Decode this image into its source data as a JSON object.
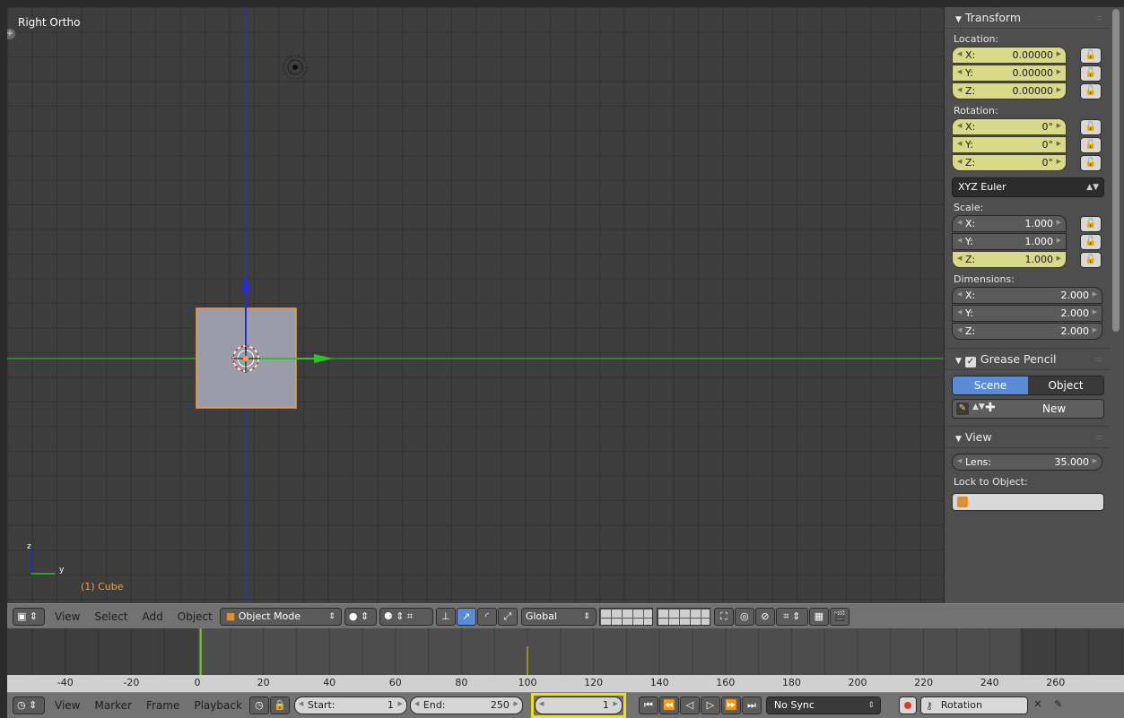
{
  "viewport": {
    "view_label": "Right Ortho",
    "object_label": "(1) Cube",
    "axis_z": "z",
    "axis_y": "y",
    "plus": "+"
  },
  "transform_panel": {
    "title": "Transform",
    "location_label": "Location:",
    "location": [
      {
        "axis": "X:",
        "value": "0.00000"
      },
      {
        "axis": "Y:",
        "value": "0.00000"
      },
      {
        "axis": "Z:",
        "value": "0.00000"
      }
    ],
    "rotation_label": "Rotation:",
    "rotation": [
      {
        "axis": "X:",
        "value": "0°"
      },
      {
        "axis": "Y:",
        "value": "0°"
      },
      {
        "axis": "Z:",
        "value": "0°"
      }
    ],
    "rotation_mode": "XYZ Euler",
    "scale_label": "Scale:",
    "scale": [
      {
        "axis": "X:",
        "value": "1.000"
      },
      {
        "axis": "Y:",
        "value": "1.000"
      },
      {
        "axis": "Z:",
        "value": "1.000"
      }
    ],
    "dimensions_label": "Dimensions:",
    "dimensions": [
      {
        "axis": "X:",
        "value": "2.000"
      },
      {
        "axis": "Y:",
        "value": "2.000"
      },
      {
        "axis": "Z:",
        "value": "2.000"
      }
    ]
  },
  "grease_pencil_panel": {
    "title": "Grease Pencil",
    "scene_tab": "Scene",
    "object_tab": "Object",
    "new_button": "New"
  },
  "view_panel": {
    "title": "View",
    "lens_label": "Lens:",
    "lens_value": "35.000",
    "lock_to_object_label": "Lock to Object:"
  },
  "viewport_header": {
    "menus": [
      "View",
      "Select",
      "Add",
      "Object"
    ],
    "mode": "Object Mode",
    "orientation": "Global"
  },
  "timeline": {
    "ruler_ticks": [
      "-40",
      "-20",
      "0",
      "20",
      "40",
      "60",
      "80",
      "100",
      "120",
      "140",
      "160",
      "180",
      "200",
      "220",
      "240",
      "260"
    ],
    "current_frame": 1,
    "keyframe": 100
  },
  "timeline_header": {
    "menus": [
      "View",
      "Marker",
      "Frame",
      "Playback"
    ],
    "start_label": "Start:",
    "start_value": "1",
    "end_label": "End:",
    "end_value": "250",
    "current_frame": "1",
    "sync": "No Sync",
    "keying_set": "Rotation"
  },
  "colors": {
    "x_axis": "#28c428",
    "z_axis": "#2a2ad8",
    "selection": "#f0a040",
    "highlight": "#f2e100",
    "active_tab": "#5a8bd6"
  }
}
